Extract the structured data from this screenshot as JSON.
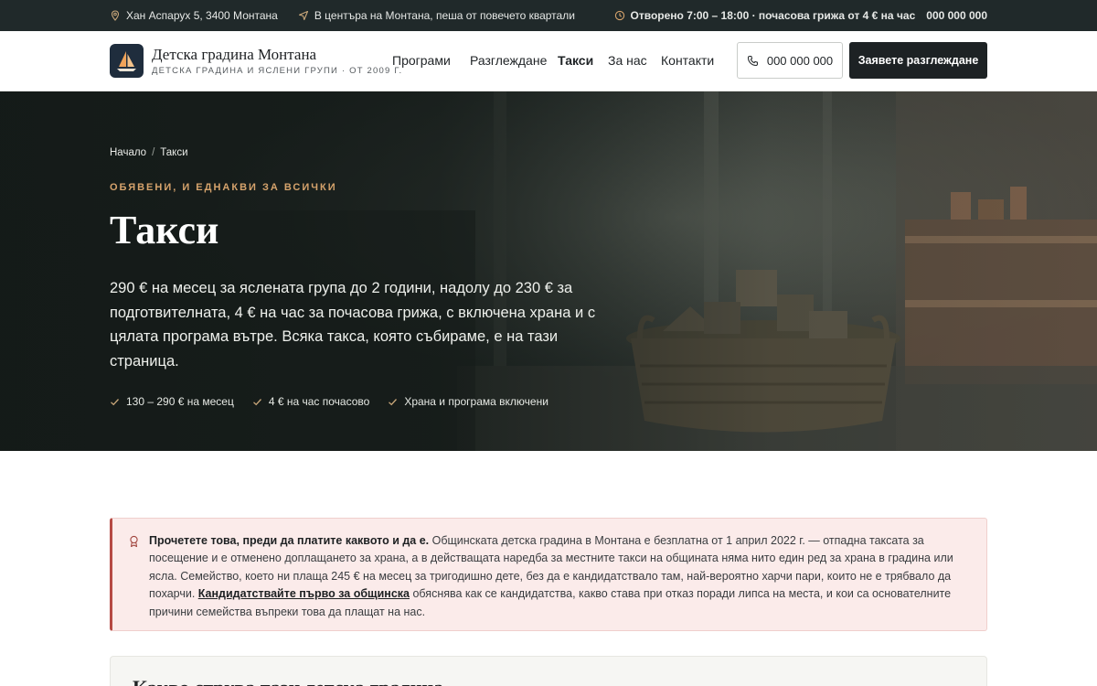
{
  "topbar": {
    "address": "Хан Аспарух 5, 3400 Монтана",
    "location_note": "В центъра на Монтана, пеша от повечето квартали",
    "hours": "Отворено 7:00 – 18:00 · почасова грижа от 4 € на час",
    "phone": "000 000 000"
  },
  "header": {
    "brand_name": "Детска градина Монтана",
    "brand_sub": "ДЕТСКА ГРАДИНА И ЯСЛЕНИ ГРУПИ · ОТ 2009 Г.",
    "nav": [
      "Програми",
      "Разглеждане",
      "Такси",
      "За нас",
      "Контакти"
    ],
    "active_nav": "Такси",
    "phone_button": "000 000 000",
    "cta_button": "Заявете разглеждане"
  },
  "hero": {
    "breadcrumb": [
      "Начало",
      "Такси"
    ],
    "eyebrow": "ОБЯВЕНИ, И ЕДНАКВИ ЗА ВСИЧКИ",
    "title": "Такси",
    "lead": "290 € на месец за яслената група до 2 години, надолу до 230 € за подготвителната, 4 € на час за почасова грижа, с включена храна и с цялата програма вътре. Всяка такса, която събираме, е на тази страница.",
    "chips": [
      "130 – 290 € на месец",
      "4 € на час почасово",
      "Храна и програма включени"
    ]
  },
  "notice": {
    "lead_bold": "Прочетете това, преди да платите каквото и да е.",
    "text_1": " Общинската детска градина в Монтана е безплатна от 1 април 2022 г. — отпадна таксата за посещение и е отменено доплащането за храна, а в действащата наредба за местните такси на общината няма нито един ред за храна в градина или ясла. Семейство, което ни плаща 245 € на месец за тригодишно дете, без да е кандидатствало там, най-вероятно харчи пари, които не е трябвало да похарчи. ",
    "link": "Кандидатствайте първо за общинска",
    "text_2": " обяснява как се кандидатства, какво става при отказ поради липса на места, и кои са основателните причини семейства въпреки това да плащат на нас."
  },
  "section": {
    "title": "Какво струва тази детска градина"
  },
  "colors": {
    "topbar_bg": "#20292a",
    "accent": "#d6a36c",
    "cta_bg": "#1d2224",
    "notice_bg": "#fbebea",
    "notice_border": "#b64a44"
  }
}
